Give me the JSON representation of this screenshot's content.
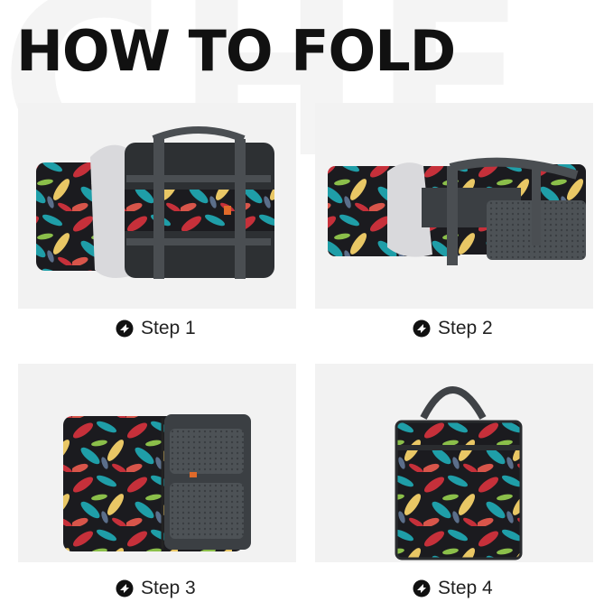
{
  "watermark": "CHF",
  "title": "HOW TO FOLD",
  "steps": [
    {
      "label": "Step 1"
    },
    {
      "label": "Step 2"
    },
    {
      "label": "Step 3"
    },
    {
      "label": "Step 4"
    }
  ],
  "colors": {
    "panel_bg": "#f2f2f2",
    "strap_gray": "#4a4e52",
    "leaf_red": "#c6303a",
    "leaf_teal": "#1f9ea8",
    "leaf_yellow": "#e9c765",
    "leaf_green": "#8bbf4a",
    "fabric_black": "#1b1b1f"
  },
  "icons": {
    "step_bullet": "circle-arrow-icon"
  }
}
